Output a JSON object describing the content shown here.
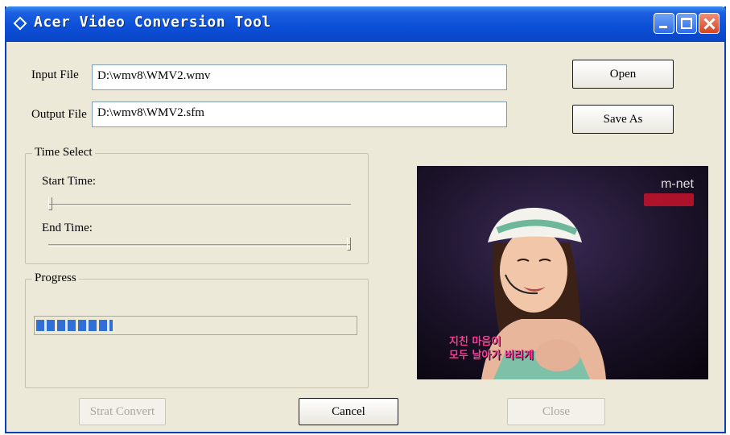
{
  "window": {
    "title": "Acer Video Conversion Tool"
  },
  "input_file": {
    "label": "Input File",
    "value": "D:\\wmv8\\WMV2.wmv"
  },
  "output_file": {
    "label": "Output File",
    "value": "D:\\wmv8\\WMV2.sfm"
  },
  "buttons": {
    "open": "Open",
    "save_as": "Save As",
    "start_convert": "Strat Convert",
    "cancel": "Cancel",
    "close": "Close"
  },
  "time_select": {
    "title": "Time Select",
    "start_label": "Start Time:",
    "end_label": "End Time:",
    "start_position": 0.0,
    "end_position": 1.0
  },
  "progress": {
    "title": "Progress",
    "value_fraction": 0.24
  },
  "preview": {
    "channel_logo": "m-net",
    "caption_line1": "지친 마음이",
    "caption_line2": "모두 날아가 버리게"
  },
  "colors": {
    "titlebar": "#0b4fd8",
    "window_bg": "#ece9d8",
    "progress_block": "#2f6fd6",
    "close_button": "#d8431c"
  }
}
